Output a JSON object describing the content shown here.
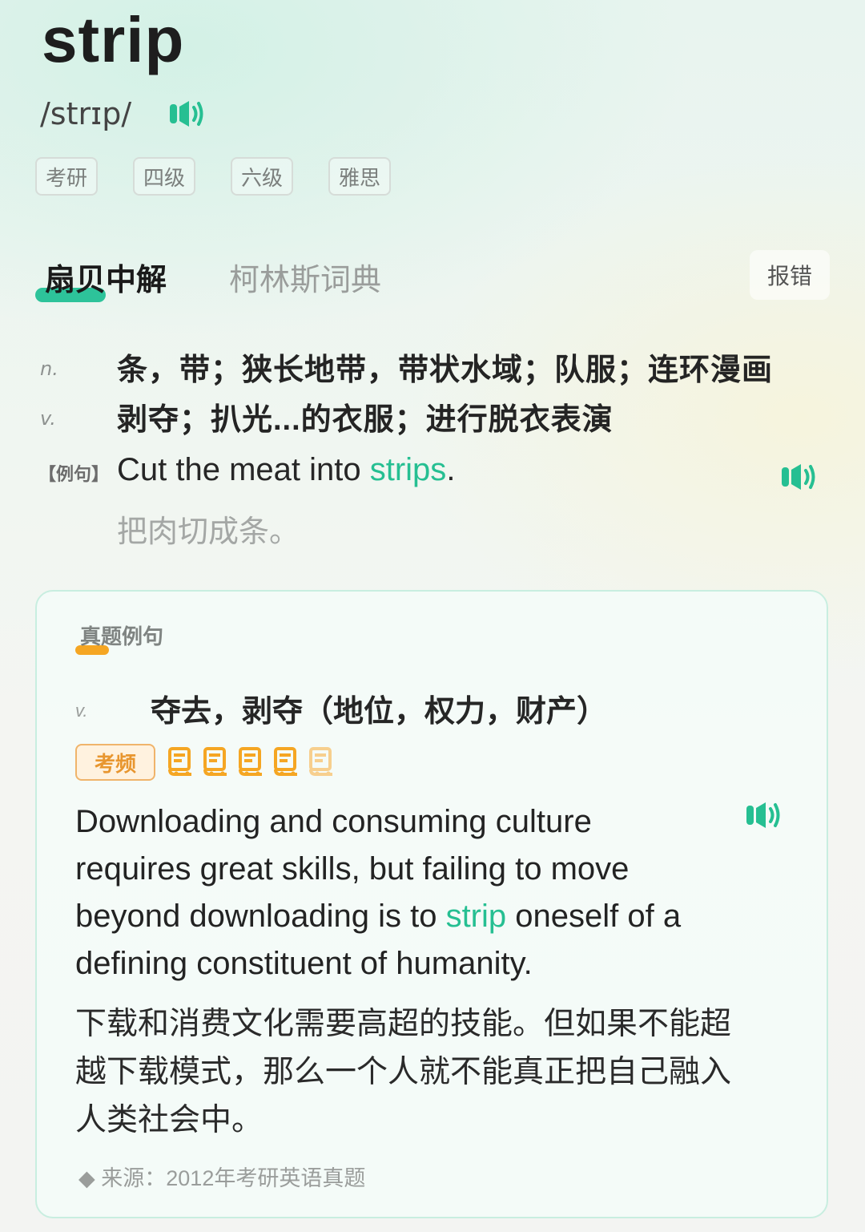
{
  "word": "strip",
  "phonetic": "/strɪp/",
  "exam_tags": [
    "考研",
    "四级",
    "六级",
    "雅思"
  ],
  "tabs": {
    "active": "扇贝中解",
    "other": "柯林斯词典"
  },
  "report_button": "报错",
  "definitions": [
    {
      "pos": "n.",
      "text": "条，带；狭长地带，带状水域；队服；连环漫画"
    },
    {
      "pos": "v.",
      "text": "剥夺；扒光...的衣服；进行脱衣表演"
    }
  ],
  "example": {
    "label": "【例句】",
    "en_before": "Cut the meat into ",
    "en_highlight": "strips",
    "en_after": ".",
    "cn": "把肉切成条。"
  },
  "real_exam": {
    "title": "真题例句",
    "pos": "v.",
    "definition": "夺去，剥夺（地位，权力，财产）",
    "freq_label": "考频",
    "frequency_stars": 4,
    "frequency_max": 5,
    "en_before": "Downloading and consuming culture requires great skills, but failing to move beyond downloading is to ",
    "en_highlight": "strip",
    "en_after": " oneself of a defining constituent of humanity.",
    "cn": "下载和消费文化需要高超的技能。但如果不能超越下载模式，那么一个人就不能真正把自己融入人类社会中。",
    "source": "◆ 来源：2012年考研英语真题"
  },
  "colors": {
    "accent": "#26bf92",
    "tab_underline": "#2dc39a",
    "freq_orange": "#f5a623"
  },
  "icons": [
    "speaker-icon",
    "book-icon",
    "diamond-icon"
  ]
}
